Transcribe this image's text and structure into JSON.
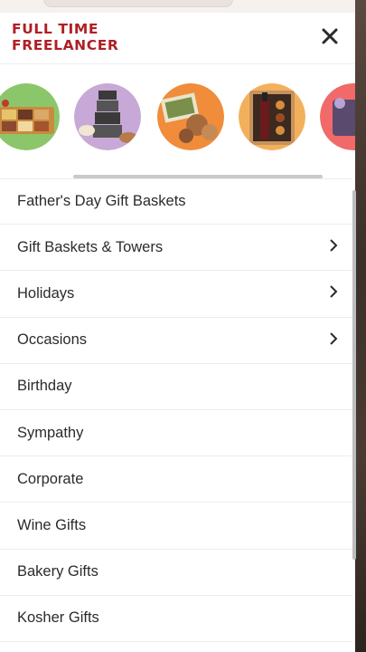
{
  "header": {
    "logo_line1": "FULL TIME",
    "logo_line2": "FREELANCER",
    "close_icon": "close-icon"
  },
  "carousel": {
    "items": [
      {
        "icon": "snack-tray-image"
      },
      {
        "icon": "tower-gift-image"
      },
      {
        "icon": "cookie-basket-image"
      },
      {
        "icon": "wine-box-image"
      },
      {
        "icon": "basket-image"
      }
    ]
  },
  "menu": {
    "items": [
      {
        "label": "Father's Day Gift Baskets",
        "has_submenu": false
      },
      {
        "label": "Gift Baskets & Towers",
        "has_submenu": true
      },
      {
        "label": "Holidays",
        "has_submenu": true
      },
      {
        "label": "Occasions",
        "has_submenu": true
      },
      {
        "label": "Birthday",
        "has_submenu": false
      },
      {
        "label": "Sympathy",
        "has_submenu": false
      },
      {
        "label": "Corporate",
        "has_submenu": false
      },
      {
        "label": "Wine Gifts",
        "has_submenu": false
      },
      {
        "label": "Bakery Gifts",
        "has_submenu": false
      },
      {
        "label": "Kosher Gifts",
        "has_submenu": false
      }
    ]
  },
  "colors": {
    "logo": "#b01f24",
    "text": "#2b2b2b",
    "divider": "#ececec"
  }
}
